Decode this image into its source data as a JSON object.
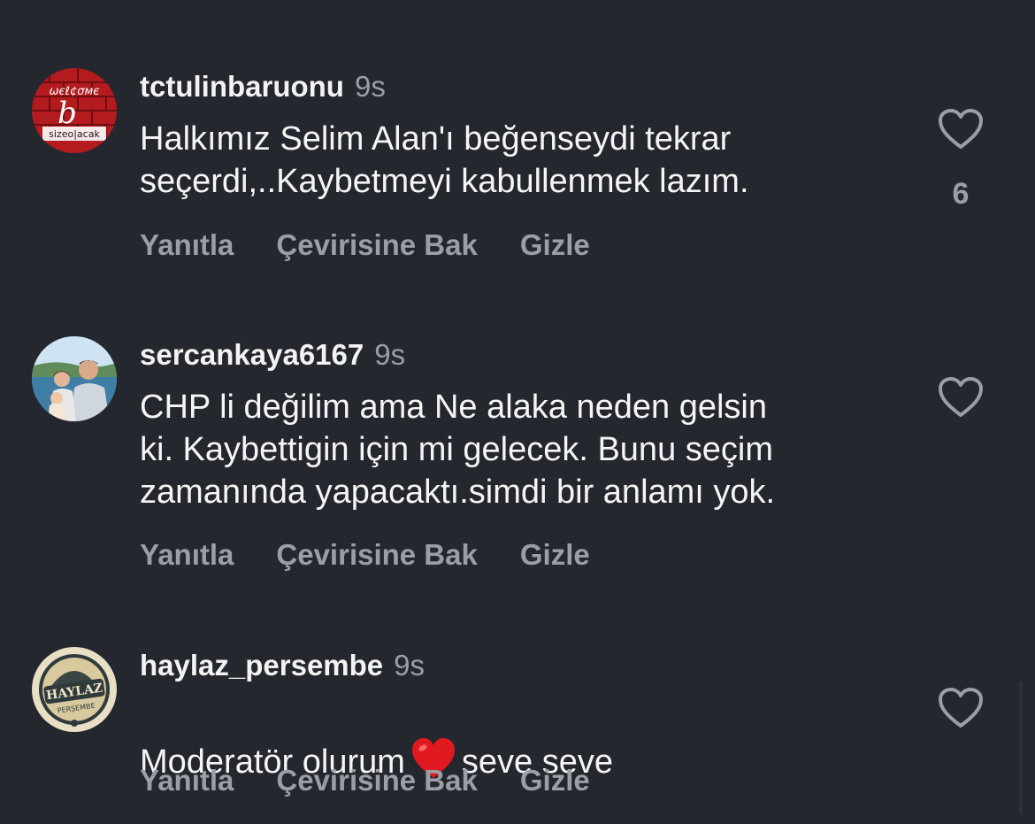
{
  "colors": {
    "background": "#24272e",
    "text": "#f5f5f5",
    "muted": "#9a9ea6",
    "emoji_heart": "#e0181f"
  },
  "actions": {
    "reply": "Yanıtla",
    "translate": "Çevirisine Bak",
    "hide": "Gizle"
  },
  "comments": [
    {
      "username": "tctulinbaruonu",
      "time": "9s",
      "text": "Halkımız Selim Alan'ı beğenseydi tekrar\nseçerdi,..Kaybetmeyi kabullenmek lazım.",
      "likes": "6",
      "avatar_text_top": "ωєℓ¢σмє",
      "avatar_text_bottom": "sizeo|acak",
      "icon": "heart-outline-icon"
    },
    {
      "username": "sercankaya6167",
      "time": "9s",
      "text": "CHP li değilim ama Ne alaka neden gelsin\nki. Kaybettigin için mi gelecek. Bunu seçim\nzamanında yapacaktı.simdi bir anlamı yok.",
      "icon": "heart-outline-icon"
    },
    {
      "username": "haylaz_persembe",
      "time": "9s",
      "text_before": "Moderatör olurum",
      "text_after": "seve seve",
      "avatar_logo_text": "HAYLAZ",
      "avatar_logo_sub": "PERŞEMBE",
      "icon": "heart-outline-icon"
    }
  ]
}
